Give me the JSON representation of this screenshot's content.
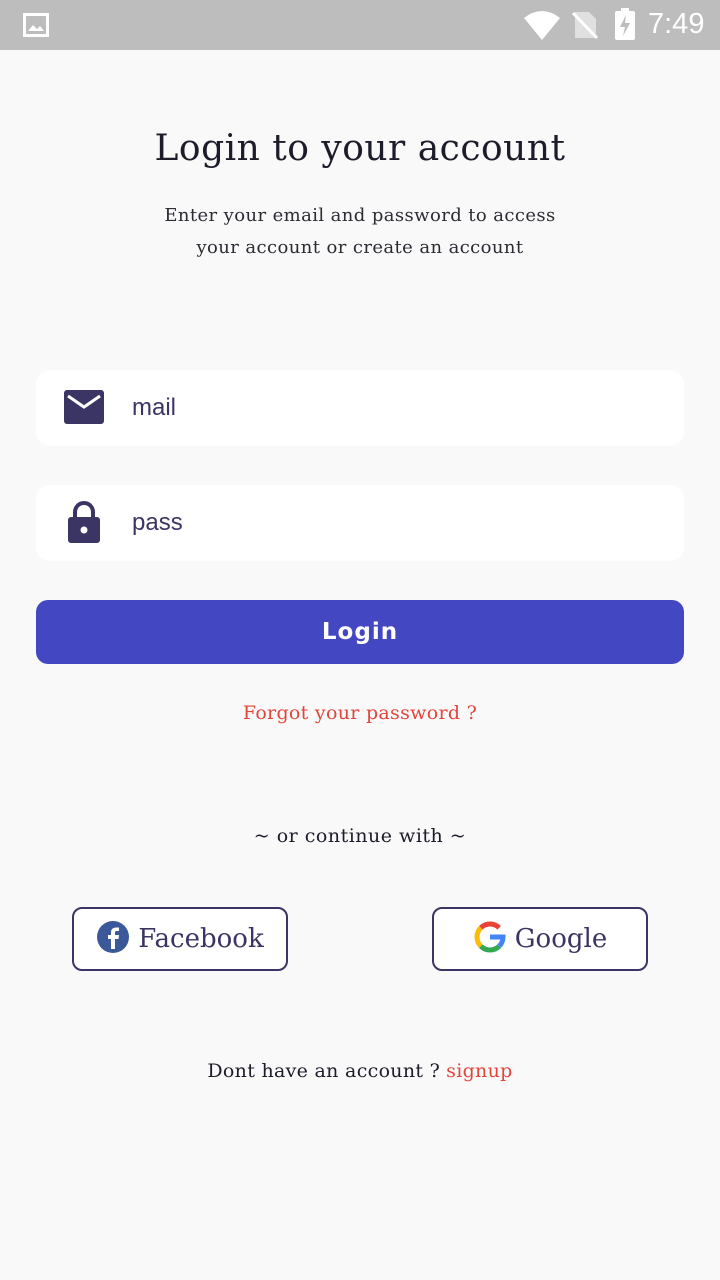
{
  "status_bar": {
    "time": "7:49",
    "icons": [
      "gallery-icon",
      "wifi-icon",
      "no-sim-icon",
      "battery-charging-icon"
    ]
  },
  "header": {
    "title": "Login to your account",
    "subtitle_line1": "Enter your email and password to access",
    "subtitle_line2": "your account or create an account"
  },
  "form": {
    "email": {
      "value": "mail",
      "icon": "mail-icon"
    },
    "password": {
      "value": "pass",
      "icon": "lock-icon"
    },
    "login_label": "Login",
    "forgot_label": "Forgot your password ?"
  },
  "social": {
    "divider_label": "~ or continue with ~",
    "facebook_label": "Facebook",
    "google_label": "Google"
  },
  "footer": {
    "question": "Dont have an account ?",
    "signup_label": "signup"
  },
  "colors": {
    "background": "#f9f9f9",
    "status_bar": "#bdbdbd",
    "primary": "#4447c2",
    "accent_red": "#e2453b",
    "icon_dark": "#3b3565"
  }
}
